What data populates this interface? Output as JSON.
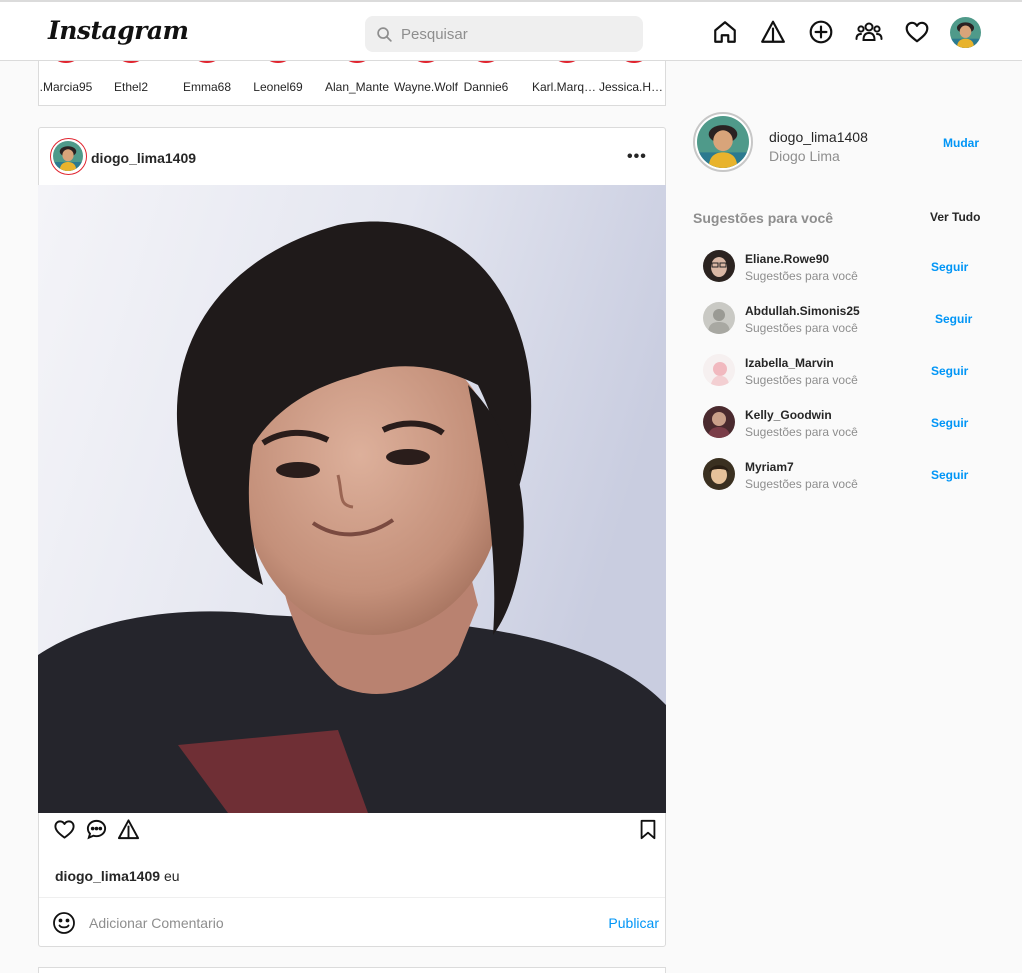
{
  "header": {
    "logo": "Instagram",
    "search_placeholder": "Pesquisar"
  },
  "icons": {
    "home": "home-icon",
    "explore": "explore-icon",
    "new_post": "add-post-icon",
    "people": "people-icon",
    "activity": "heart-icon"
  },
  "stories": [
    {
      "name": ".Marcia95"
    },
    {
      "name": "Ethel2"
    },
    {
      "name": "Emma68"
    },
    {
      "name": "Leonel69"
    },
    {
      "name": "Alan_Mante"
    },
    {
      "name": "Wayne.Wolf"
    },
    {
      "name": "Dannie6"
    },
    {
      "name": "Karl.Marquardt"
    },
    {
      "name": "Jessica.Hackett"
    }
  ],
  "post": {
    "username": "diogo_lima1409",
    "more": "•••",
    "caption_user": "diogo_lima1409",
    "caption_text": "eu",
    "comment_placeholder": "Adicionar Comentario",
    "publish_label": "Publicar"
  },
  "sidebar": {
    "username": "diogo_lima1408",
    "full_name": "Diogo Lima",
    "switch_label": "Mudar",
    "suggestions_title": "Sugestões para você",
    "see_all_label": "Ver Tudo",
    "suggestions": [
      {
        "username": "Eliane.Rowe90",
        "subtitle": "Sugestões para você",
        "follow": "Seguir"
      },
      {
        "username": "Abdullah.Simonis25",
        "subtitle": "Sugestões para você",
        "follow": "Seguir"
      },
      {
        "username": "Izabella_Marvin",
        "subtitle": "Sugestões para você",
        "follow": "Seguir"
      },
      {
        "username": "Kelly_Goodwin",
        "subtitle": "Sugestões para você",
        "follow": "Seguir"
      },
      {
        "username": "Myriam7",
        "subtitle": "Sugestões para você",
        "follow": "Seguir"
      }
    ]
  },
  "colors": {
    "accent_blue": "#0095f6",
    "story_ring": "#e0242f",
    "border": "#dbdbdb",
    "background": "#fafafa"
  }
}
